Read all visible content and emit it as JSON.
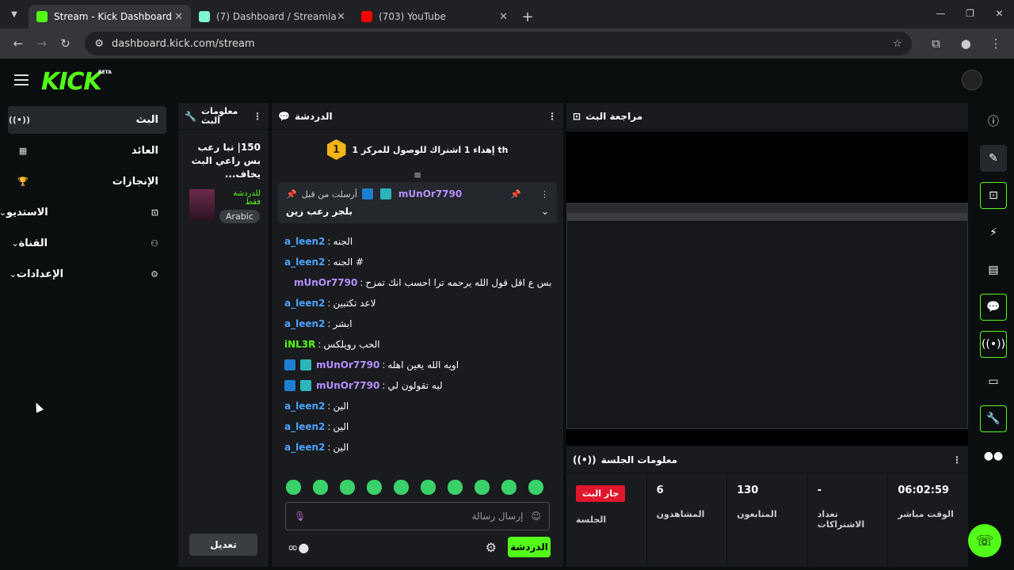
{
  "browser": {
    "tabs": [
      {
        "title": "Stream - Kick Dashboard",
        "color": "#53fc18",
        "active": true
      },
      {
        "title": "(7) Dashboard / Streamlabs",
        "color": "#80f5d2",
        "active": false
      },
      {
        "title": "(703) YouTube",
        "color": "#ff0000",
        "active": false
      }
    ],
    "url": "dashboard.kick.com/stream"
  },
  "header": {
    "logo": "KICK",
    "beta": "BETA"
  },
  "sidebar": {
    "items": [
      {
        "label": "البث",
        "icon": "broadcast-icon"
      },
      {
        "label": "العائد",
        "icon": "revenue-icon"
      },
      {
        "label": "الإنجازات",
        "icon": "trophy-icon"
      },
      {
        "label": "الاستديو",
        "icon": "studio-icon"
      },
      {
        "label": "القناة",
        "icon": "channel-icon"
      },
      {
        "label": "الإعدادات",
        "icon": "gear-icon"
      }
    ]
  },
  "stream_info": {
    "header": "معلومات البث",
    "title": "150| نبا رعب بس راعي البث يخاف...",
    "category": "للدردشة فقط",
    "tag": "Arabic",
    "edit_label": "تعديل"
  },
  "chat": {
    "header": "الدردشة",
    "goal_number": "1",
    "goal_text": "إهداء 1 اشتراك للوصول للمركز 1 th",
    "pinned": {
      "by_label": "أرسلت من قبل",
      "user": "mUnOr7790",
      "message": "بلجر رعب زين"
    },
    "messages": [
      {
        "user": "a_leen2",
        "color": "#4da3ff",
        "text": "الجنه",
        "badges": 0
      },
      {
        "user": "a_leen2",
        "color": "#4da3ff",
        "text": "الجنه #",
        "badges": 0
      },
      {
        "user": "mUnOr7790",
        "color": "#b690ff",
        "text": "بس ع اقل قول الله يرحمه ترا احسب انك تمزح",
        "badges": 2
      },
      {
        "user": "a_leen2",
        "color": "#4da3ff",
        "text": "لاعد تكتبين",
        "badges": 0
      },
      {
        "user": "a_leen2",
        "color": "#4da3ff",
        "text": "ابشر",
        "badges": 0
      },
      {
        "user": "iNL3R",
        "color": "#53fc18",
        "text": "الحب رويلكس",
        "badges": 0
      },
      {
        "user": "mUnOr7790",
        "color": "#b690ff",
        "text": "اويه الله يعين اهله",
        "badges": 2
      },
      {
        "user": "mUnOr7790",
        "color": "#b690ff",
        "text": "ليه تقولون لي",
        "badges": 2
      },
      {
        "user": "a_leen2",
        "color": "#4da3ff",
        "text": "الين",
        "badges": 0
      },
      {
        "user": "a_leen2",
        "color": "#4da3ff",
        "text": "الين",
        "badges": 0
      },
      {
        "user": "a_leen2",
        "color": "#4da3ff",
        "text": "الين",
        "badges": 0
      }
    ],
    "input_placeholder": "إرسال رسالة",
    "send_label": "الدردشة"
  },
  "preview": {
    "header": "مراجعة البث"
  },
  "session": {
    "header": "معلومات الجلسة",
    "cells": [
      {
        "value": "6",
        "key": "المشاهدون"
      },
      {
        "value": "130",
        "key": "المتابعون"
      },
      {
        "value": "-",
        "key": "تعداد الاشتراكات"
      },
      {
        "value": "06:02:59",
        "key": "الوقت مباشر"
      }
    ],
    "live_badge": "جار البث",
    "session_label": "الجلسة"
  },
  "rail": {
    "icons": [
      "info-icon",
      "edit-icon",
      "camera-icon",
      "lightning-icon",
      "document-icon",
      "chat-icon",
      "broadcast-icon",
      "layout-icon",
      "wrench-icon",
      "dots-icon"
    ]
  }
}
